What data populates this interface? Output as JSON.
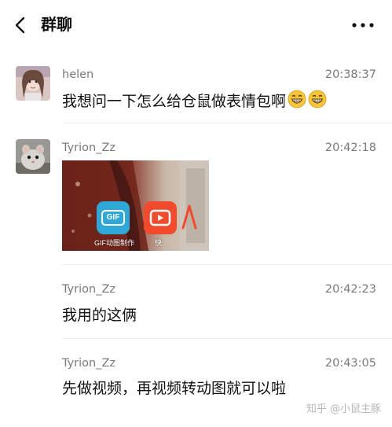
{
  "header": {
    "title": "群聊",
    "back_icon": "chevron-left-icon",
    "more_icon": "more-dots-icon"
  },
  "messages": [
    {
      "sender": "helen",
      "time": "20:38:37",
      "text": "我想问一下怎么给仓鼠做表情包啊",
      "emojis": [
        "grinning-face-icon",
        "grinning-face-icon"
      ]
    },
    {
      "sender": "Tyrion_Zz",
      "time": "20:42:18",
      "image": {
        "apps": [
          {
            "label": "GIF动图制作",
            "icon_text": "GIF",
            "color": "#2fa8d8"
          },
          {
            "label": "快",
            "color": "#f24a2c"
          }
        ]
      }
    },
    {
      "sender": "Tyrion_Zz",
      "time": "20:42:23",
      "text": "我用的这俩"
    },
    {
      "sender": "Tyrion_Zz",
      "time": "20:43:05",
      "text": "先做视频，再视频转动图就可以啦"
    }
  ],
  "watermark": "知乎 @小鼠主豚"
}
